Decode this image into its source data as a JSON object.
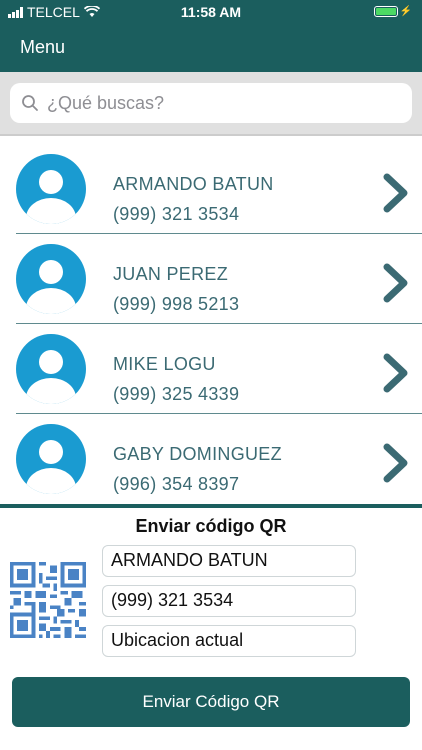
{
  "status_bar": {
    "carrier": "TELCEL",
    "time": "11:58 AM"
  },
  "nav": {
    "menu_label": "Menu"
  },
  "search": {
    "placeholder": "¿Qué buscas?"
  },
  "contacts": [
    {
      "name": "ARMANDO BATUN",
      "phone": "(999) 321 3534"
    },
    {
      "name": "JUAN PEREZ",
      "phone": "(999) 998 5213"
    },
    {
      "name": "MIKE LOGU",
      "phone": "(999) 325 4339"
    },
    {
      "name": "GABY DOMINGUEZ",
      "phone": "(996) 354 8397"
    }
  ],
  "qr_panel": {
    "title": "Enviar código QR",
    "name_value": "ARMANDO BATUN",
    "phone_value": "(999) 321 3534",
    "location_value": "Ubicacion actual",
    "send_label": "Enviar Código QR"
  },
  "colors": {
    "primary": "#1b5e5e",
    "avatar": "#1a9bd1",
    "text_accent": "#3b6a73",
    "qr": "#4a83c5"
  }
}
